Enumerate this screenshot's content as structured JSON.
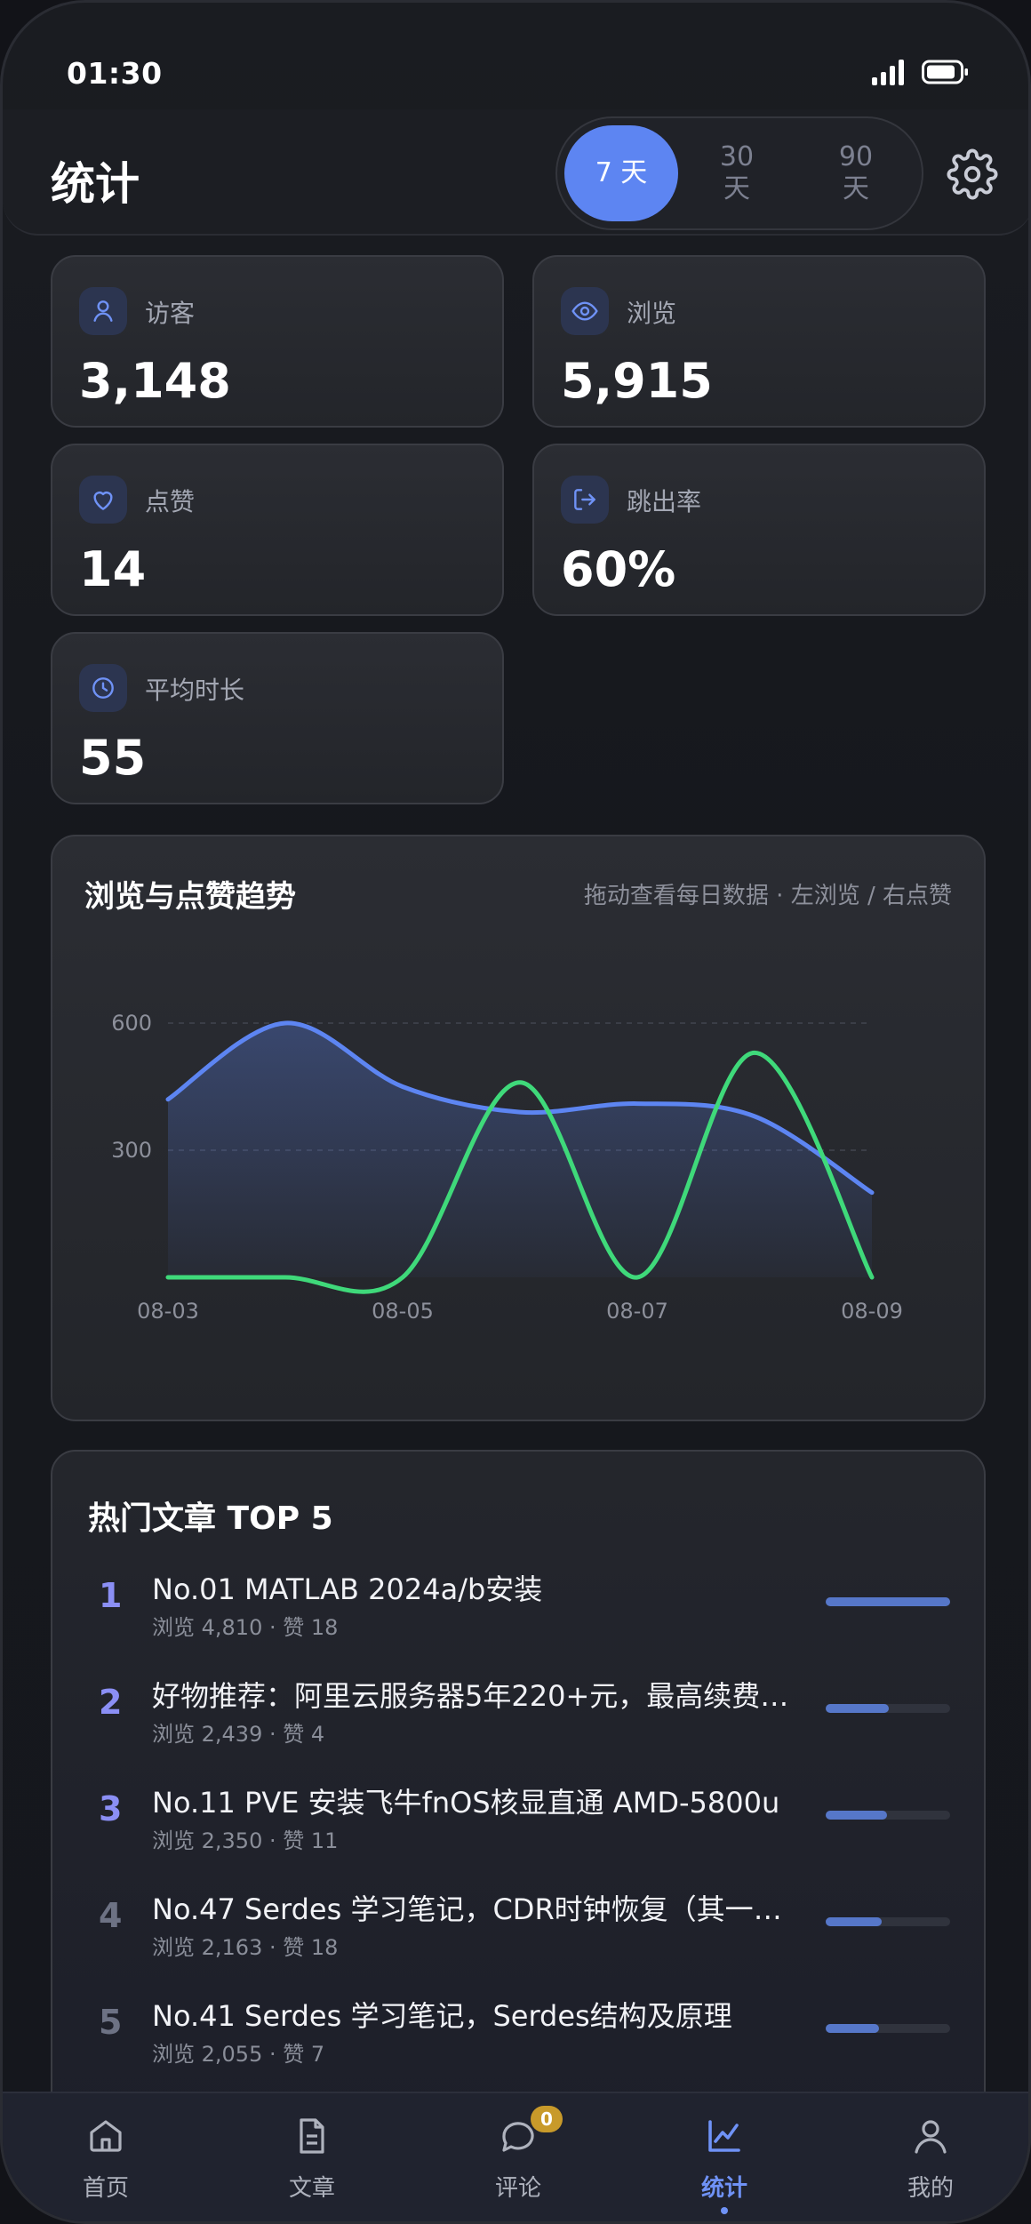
{
  "status": {
    "time": "01:30"
  },
  "header": {
    "title": "统计",
    "ranges": [
      {
        "label": "7 天",
        "active": true
      },
      {
        "label": "30 天",
        "active": false
      },
      {
        "label": "90 天",
        "active": false
      }
    ]
  },
  "stats": [
    {
      "label": "访客",
      "value": "3,148",
      "icon": "user-icon"
    },
    {
      "label": "浏览",
      "value": "5,915",
      "icon": "eye-icon"
    },
    {
      "label": "点赞",
      "value": "14",
      "icon": "heart-icon"
    },
    {
      "label": "跳出率",
      "value": "60%",
      "icon": "exit-icon"
    },
    {
      "label": "平均时长",
      "value": "55",
      "icon": "clock-icon"
    }
  ],
  "trend": {
    "title": "浏览与点赞趋势",
    "hint": "拖动查看每日数据 · 左浏览 / 右点赞"
  },
  "chart_data": {
    "type": "line",
    "x": [
      "08-03",
      "08-04",
      "08-05",
      "08-06",
      "08-07",
      "08-08",
      "08-09"
    ],
    "x_tick_labels": [
      "08-03",
      "08-05",
      "08-07",
      "08-09"
    ],
    "y_ticks": [
      300,
      600
    ],
    "ylim": [
      0,
      600
    ],
    "grid": true,
    "series": [
      {
        "color": "#5d85f2",
        "values": [
          420,
          600,
          450,
          390,
          410,
          380,
          200
        ],
        "fill": true
      },
      {
        "color": "#3fd97a",
        "values": [
          0,
          0,
          0,
          460,
          0,
          530,
          0
        ]
      }
    ]
  },
  "top": {
    "title": "热门文章 TOP 5",
    "items": [
      {
        "rank": "1",
        "title": "No.01 MATLAB 2024a/b安装",
        "meta": "浏览 4,810 · 赞 18",
        "ratio": 1.0,
        "rank_color": "#8b8ff5"
      },
      {
        "rank": "2",
        "title": "好物推荐：阿里云服务器5年220+元，最高续费1...",
        "meta": "浏览 2,439 · 赞 4",
        "ratio": 0.51,
        "rank_color": "#8b8ff5"
      },
      {
        "rank": "3",
        "title": "No.11 PVE 安装飞牛fnOS核显直通 AMD-5800u",
        "meta": "浏览 2,350 · 赞 11",
        "ratio": 0.49,
        "rank_color": "#8b8ff5"
      },
      {
        "rank": "4",
        "title": "No.47 Serdes 学习笔记，CDR时钟恢复（其一，...",
        "meta": "浏览 2,163 · 赞 18",
        "ratio": 0.45,
        "rank_color": "#6d7284"
      },
      {
        "rank": "5",
        "title": "No.41 Serdes 学习笔记，Serdes结构及原理",
        "meta": "浏览 2,055 · 赞 7",
        "ratio": 0.43,
        "rank_color": "#6d7284"
      }
    ]
  },
  "tabs": [
    {
      "label": "首页",
      "icon": "home-icon",
      "active": false
    },
    {
      "label": "文章",
      "icon": "document-icon",
      "active": false
    },
    {
      "label": "评论",
      "icon": "comment-icon",
      "active": false,
      "badge": "0"
    },
    {
      "label": "统计",
      "icon": "chart-icon",
      "active": true
    },
    {
      "label": "我的",
      "icon": "profile-icon",
      "active": false
    }
  ]
}
